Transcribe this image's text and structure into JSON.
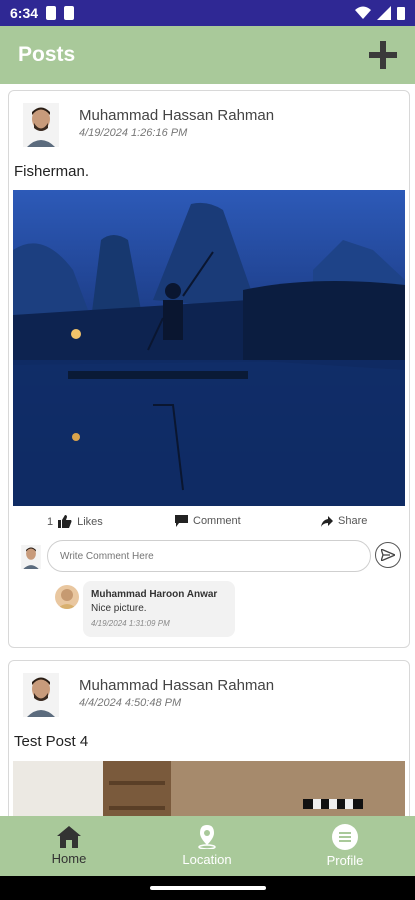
{
  "status": {
    "time": "6:34"
  },
  "app": {
    "title": "Posts"
  },
  "posts": [
    {
      "author": "Muhammad Hassan Rahman",
      "date": "4/19/2024 1:26:16 PM",
      "text": "Fisherman.",
      "likes_count": "1",
      "likes_label": "Likes",
      "comment_label": "Comment",
      "share_label": "Share",
      "comment_placeholder": "Write Comment Here",
      "comments": [
        {
          "author": "Muhammad Haroon Anwar",
          "text": "Nice picture.",
          "date": "4/19/2024 1:31:09 PM"
        }
      ]
    },
    {
      "author": "Muhammad Hassan Rahman",
      "date": "4/4/2024 4:50:48 PM",
      "text": "Test Post 4"
    }
  ],
  "nav": {
    "items": [
      {
        "label": "Home",
        "icon": "home-icon"
      },
      {
        "label": "Location",
        "icon": "location-icon"
      },
      {
        "label": "Profile",
        "icon": "profile-icon"
      }
    ]
  },
  "colors": {
    "accent": "#a9c99a",
    "status_bar": "#2f2894"
  }
}
